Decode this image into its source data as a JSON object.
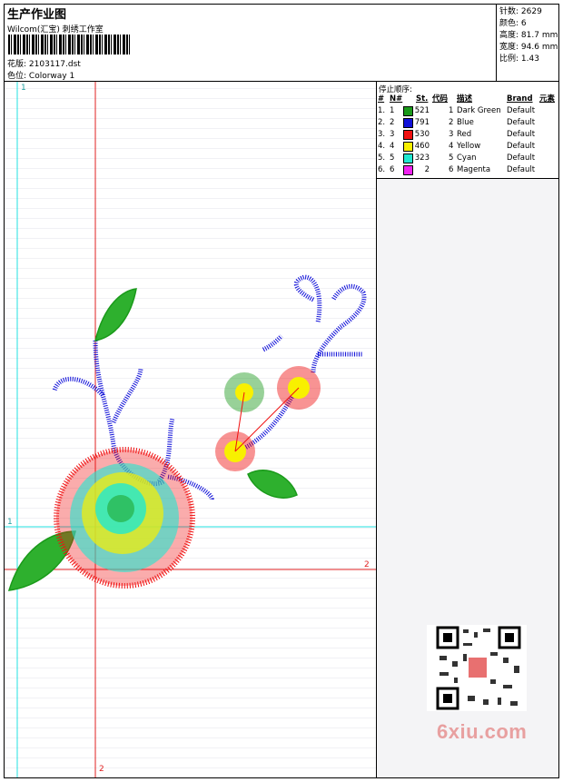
{
  "header": {
    "title": "生产作业图",
    "subtitle": "Wilcom(汇宝) 刺绣工作室",
    "design_label": "花版:",
    "design_value": "2103117.dst",
    "colorway_label": "色位:",
    "colorway_value": "Colorway 1"
  },
  "stats": [
    {
      "label": "针数:",
      "value": "2629"
    },
    {
      "label": "颜色:",
      "value": "6"
    },
    {
      "label": "高度:",
      "value": "81.7 mm"
    },
    {
      "label": "宽度:",
      "value": "94.6 mm"
    },
    {
      "label": "比例:",
      "value": "1.43"
    }
  ],
  "sequence": {
    "caption": "停止顺序:",
    "headers": {
      "num": "#",
      "n": "N#",
      "st": "St.",
      "code": "代码",
      "desc": "描述",
      "brand": "Brand",
      "elem": "元素"
    },
    "rows": [
      {
        "num": "1.",
        "n": "1",
        "color": "#1a9a1a",
        "st": "521",
        "code": "1",
        "desc": "Dark Green",
        "brand": "Default"
      },
      {
        "num": "2.",
        "n": "2",
        "color": "#1010d8",
        "st": "791",
        "code": "2",
        "desc": "Blue",
        "brand": "Default"
      },
      {
        "num": "3.",
        "n": "3",
        "color": "#f01010",
        "st": "530",
        "code": "3",
        "desc": "Red",
        "brand": "Default"
      },
      {
        "num": "4.",
        "n": "4",
        "color": "#f8f000",
        "st": "460",
        "code": "4",
        "desc": "Yellow",
        "brand": "Default"
      },
      {
        "num": "5.",
        "n": "5",
        "color": "#20e8d0",
        "st": "323",
        "code": "5",
        "desc": "Cyan",
        "brand": "Default"
      },
      {
        "num": "6.",
        "n": "6",
        "color": "#f020f0",
        "st": "2",
        "code": "6",
        "desc": "Magenta",
        "brand": "Default"
      }
    ]
  },
  "axes": {
    "top1": "1",
    "left1": "1",
    "right2": "2",
    "bottom2": "2"
  },
  "watermark": "6xiu.com"
}
